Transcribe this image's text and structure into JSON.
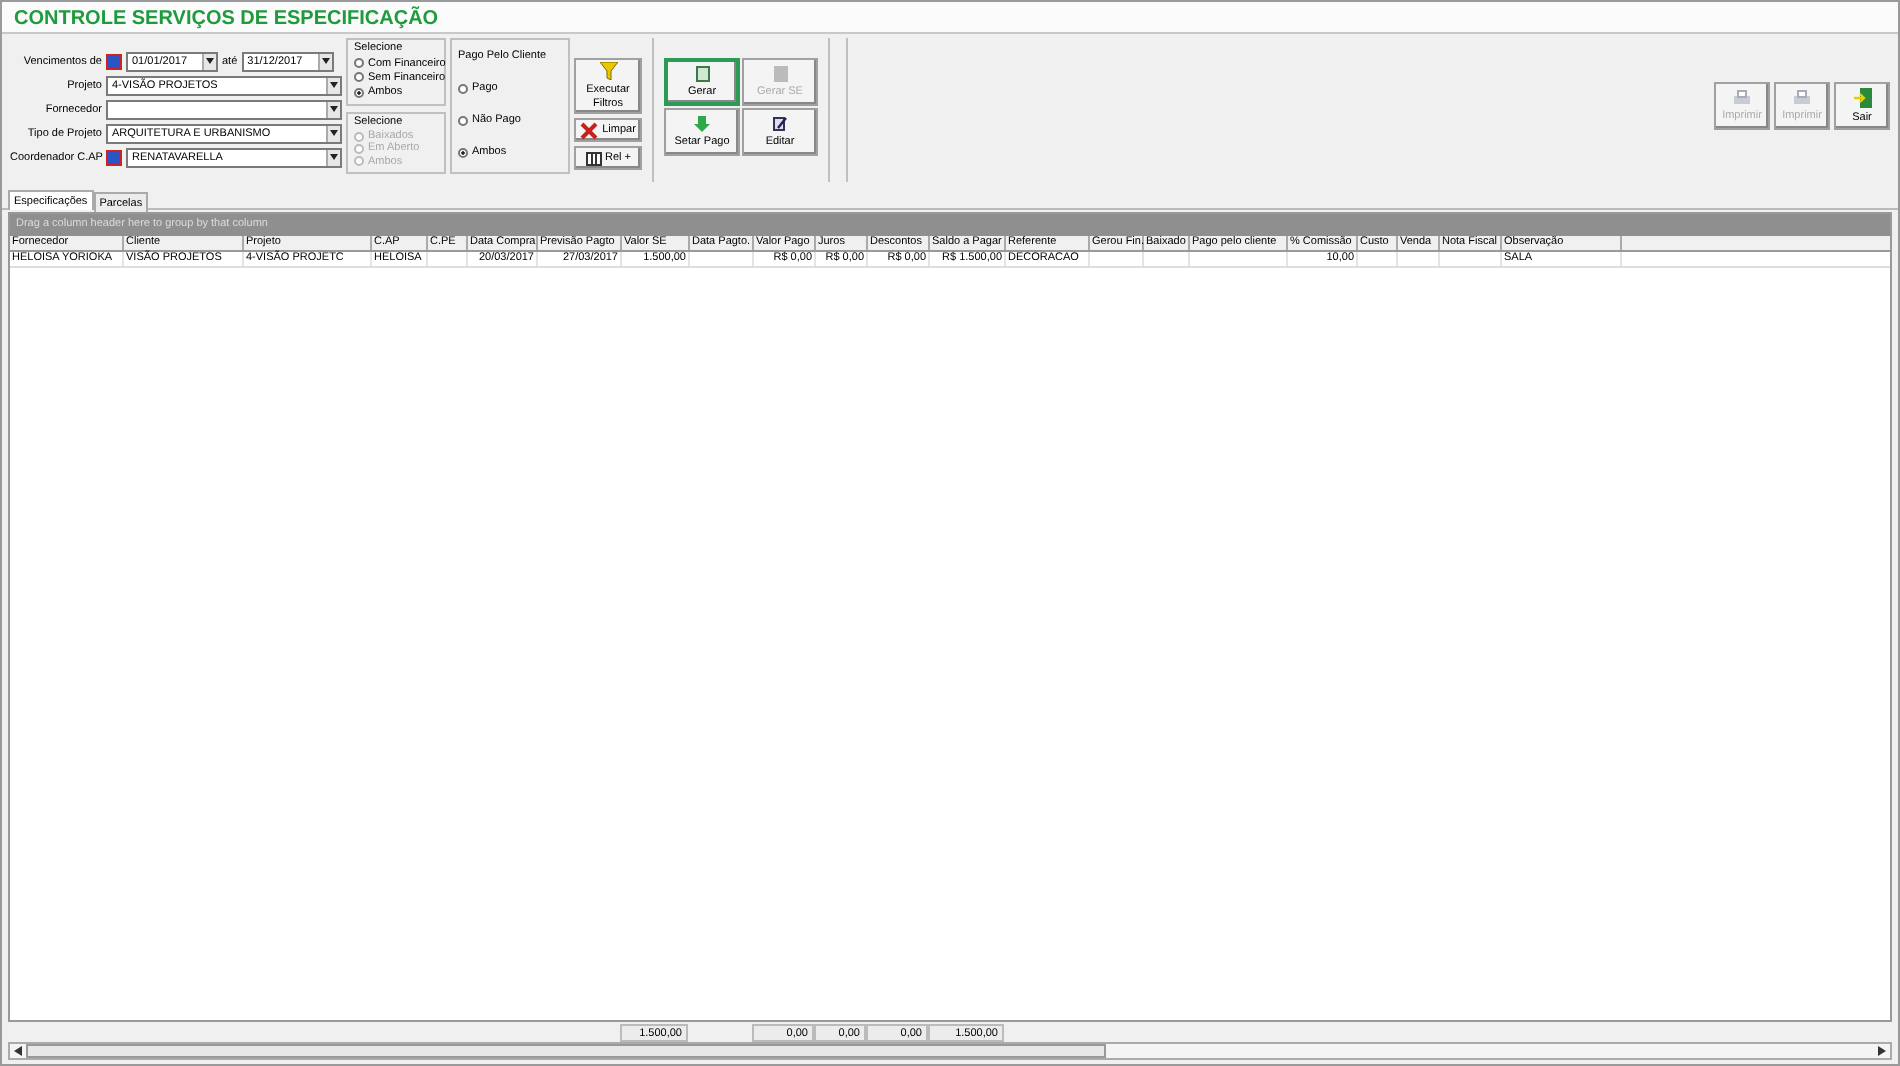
{
  "window": {
    "title": "CONTROLE SERVIÇOS DE ESPECIFICAÇÃO"
  },
  "filters": {
    "date_range": {
      "label": "Vencimentos de",
      "from": "01/01/2017",
      "separator": "até",
      "to": "31/12/2017"
    },
    "fields": [
      {
        "label": "Projeto",
        "value": "4-VISÃO PROJETOS",
        "icon": false
      },
      {
        "label": "Fornecedor",
        "icon": false
      },
      {
        "label": "Tipo de Projeto",
        "value": "ARQUITETURA E URBANISMO",
        "icon": false
      },
      {
        "label": "Coordenador C.AP",
        "value": "RENATAVARELLA",
        "icon": true
      }
    ]
  },
  "radio_groups": [
    {
      "title": "Selecione",
      "disabled": false,
      "options": [
        {
          "label": "Com Financeiro",
          "selected": false
        },
        {
          "label": "Sem Financeiro",
          "selected": false
        },
        {
          "label": "Ambos",
          "selected": true
        }
      ]
    },
    {
      "title": "Selecione",
      "disabled": true,
      "options": [
        {
          "label": "Baixados",
          "selected": false
        },
        {
          "label": "Em Aberto",
          "selected": false
        },
        {
          "label": "Ambos",
          "selected": false
        }
      ]
    }
  ],
  "paid_by_client": {
    "title": "Pago Pelo Cliente",
    "options": [
      {
        "label": "Pago",
        "selected": false
      },
      {
        "label": "Não Pago",
        "selected": false
      },
      {
        "label": "Ambos",
        "selected": true
      }
    ]
  },
  "filter_buttons": [
    {
      "label": "Executar Filtros",
      "kind": "filter"
    },
    {
      "label": "Limpar",
      "kind": "clear"
    },
    {
      "label": "Rel +",
      "kind": "report"
    }
  ],
  "action_buttons": [
    {
      "label": "Gerar",
      "kind": "generate",
      "disabled": false,
      "focused": true
    },
    {
      "label": "Gerar SE",
      "kind": "generate-se",
      "disabled": true,
      "focused": false
    },
    {
      "label": "Setar Pago",
      "kind": "paid",
      "disabled": false,
      "focused": false
    },
    {
      "label": "Editar",
      "kind": "edit",
      "disabled": false,
      "focused": false
    }
  ],
  "print_buttons": [
    {
      "label": "Imprimir",
      "kind": "print",
      "disabled": true
    },
    {
      "label": "Imprimir",
      "kind": "print",
      "disabled": true
    },
    {
      "label": "Sair",
      "kind": "exit",
      "disabled": false
    }
  ],
  "tabs": [
    {
      "label": "Especificações",
      "selected": true
    },
    {
      "label": "Parcelas",
      "selected": false
    }
  ],
  "group_panel": "Drag a column header here to group by that column",
  "table": {
    "columns": [
      {
        "label": "Fornecedor"
      },
      {
        "label": "Cliente"
      },
      {
        "label": "Projeto"
      },
      {
        "label": "C.AP"
      },
      {
        "label": "C.PE"
      },
      {
        "label": "Data Compra"
      },
      {
        "label": "Previsão Pagto"
      },
      {
        "label": "Valor SE",
        "total": "1.500,00"
      },
      {
        "label": "Data Pagto."
      },
      {
        "label": "Valor Pago",
        "total": "0,00"
      },
      {
        "label": "Juros",
        "total": "0,00"
      },
      {
        "label": "Descontos",
        "total": "0,00"
      },
      {
        "label": "Saldo a Pagar",
        "total": "1.500,00"
      },
      {
        "label": "Referente"
      },
      {
        "label": "Gerou Fin."
      },
      {
        "label": "Baixado"
      },
      {
        "label": "Pago pelo cliente"
      },
      {
        "label": "% Comissão"
      },
      {
        "label": "Custo"
      },
      {
        "label": "Venda"
      },
      {
        "label": "Nota Fiscal"
      },
      {
        "label": "Observação"
      }
    ],
    "rows": [
      {
        "selected": false,
        "cells": [
          "HELOISA YORIOKA",
          "VISÃO PROJETOS",
          "4-VISÃO PROJETC",
          "HELOISA",
          "",
          "20/03/2017",
          "27/03/2017",
          "1.500,00",
          "",
          "R$ 0,00",
          "R$ 0,00",
          "R$ 0,00",
          "R$ 1.500,00",
          "DECORACAO",
          "",
          "",
          "",
          "10,00",
          "",
          "",
          "",
          "SALA"
        ]
      }
    ]
  }
}
